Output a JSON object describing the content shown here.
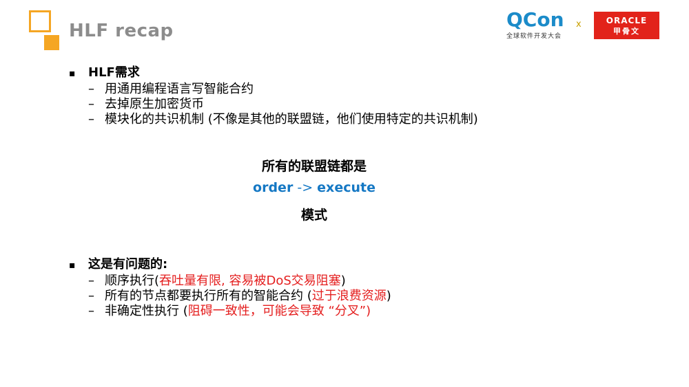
{
  "header": {
    "title": "HLF recap"
  },
  "logos": {
    "qcon_main": "QCon",
    "qcon_sub": "全球软件开发大会",
    "separator": "x",
    "oracle_en": "ORACLE",
    "oracle_cn": "甲骨文"
  },
  "section1": {
    "heading": "HLF需求",
    "items": [
      "用通用编程语言写智能合约",
      "去掉原生加密货币",
      "模块化的共识机制 (不像是其他的联盟链，他们使用特定的共识机制)"
    ]
  },
  "center": {
    "line1": "所有的联盟链都是",
    "order": "order",
    "arrow": " -> ",
    "execute": "execute",
    "line3": "模式"
  },
  "section2": {
    "heading": "这是有问题的:",
    "items": [
      {
        "pre": "顺序执行(",
        "red": "吞吐量有限, 容易被DoS交易阻塞",
        "post": ")"
      },
      {
        "pre": "所有的节点都要执行所有的智能合约 (",
        "red": "过于浪费资源",
        "post": ")"
      },
      {
        "pre": "非确定性执行 (",
        "red": "阻碍一致性，可能会导致 “分叉”)",
        "post": ""
      }
    ]
  },
  "colors": {
    "accent": "#f5a623",
    "title_gray": "#8c8c8c",
    "highlight_red": "#e41e1e",
    "flow_blue": "#1578c4",
    "oracle_red": "#e2231a"
  }
}
